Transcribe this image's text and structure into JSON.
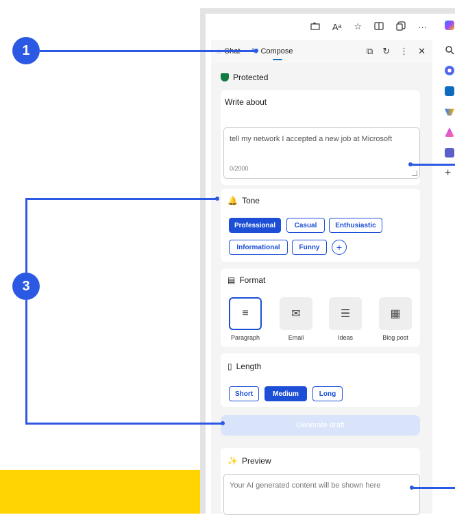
{
  "callouts": {
    "one": "1",
    "three": "3"
  },
  "toolbar": {
    "icons": [
      "tab-icon",
      "read-aloud-icon",
      "favorite-icon",
      "split-screen-icon",
      "collections-icon",
      "more-icon",
      "copilot-icon"
    ],
    "read_aloud_label": "Aᵃ",
    "more_label": "···"
  },
  "tabs": {
    "chat_label": "Chat",
    "compose_label": "Compose"
  },
  "status": {
    "protected_label": "Protected"
  },
  "write_about": {
    "title": "Write about",
    "value": "tell my network I accepted a new job at Microsoft",
    "counter": "0/2000"
  },
  "tone": {
    "title": "Tone",
    "options": [
      "Professional",
      "Casual",
      "Enthusiastic",
      "Informational",
      "Funny"
    ],
    "selected": "Professional",
    "add_label": "+"
  },
  "format": {
    "title": "Format",
    "options": [
      "Paragraph",
      "Email",
      "Ideas",
      "Blog post"
    ],
    "selected": "Paragraph"
  },
  "length": {
    "title": "Length",
    "options": [
      "Short",
      "Medium",
      "Long"
    ],
    "selected": "Medium"
  },
  "generate": {
    "label": "Generate draft"
  },
  "preview": {
    "title": "Preview",
    "placeholder": "Your AI generated content will be shown here"
  },
  "colors": {
    "accent": "#1c4fd6",
    "callout": "#2b59e3",
    "band": "#ffd400",
    "protected": "#107c41"
  }
}
